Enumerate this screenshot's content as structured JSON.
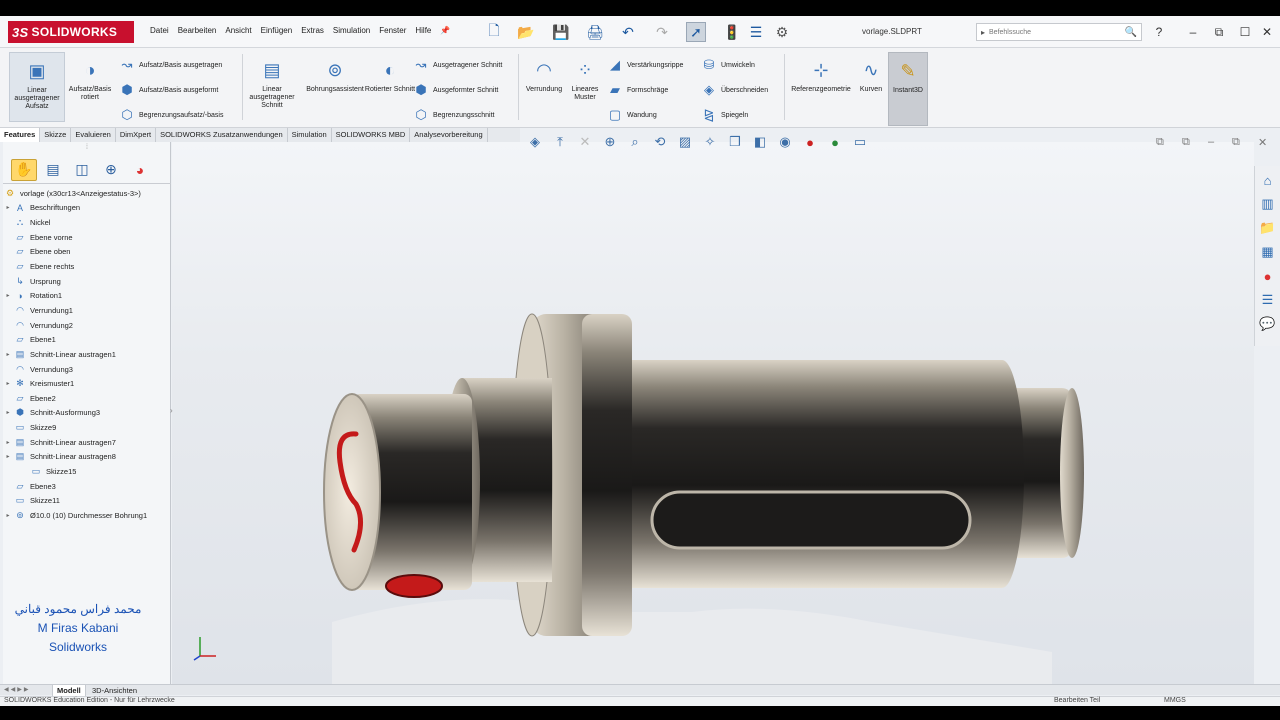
{
  "app": {
    "brand": "SOLIDWORKS",
    "brand_prefix": "3S",
    "document_title": "vorlage.SLDPRT"
  },
  "menu": [
    "Datei",
    "Bearbeiten",
    "Ansicht",
    "Einfügen",
    "Extras",
    "Simulation",
    "Fenster",
    "Hilfe"
  ],
  "search": {
    "placeholder": "Befehlssuche"
  },
  "ribbon": {
    "linear_boss": "Linear ausgetragener Aufsatz",
    "revolve_boss": "Aufsatz/Basis rotiert",
    "swept_boss": "Aufsatz/Basis ausgetragen",
    "lofted_boss": "Aufsatz/Basis ausgeformt",
    "boundary_boss": "Begrenzungsaufsatz/-basis",
    "linear_cut": "Linear ausgetragener Schnitt",
    "hole_wizard": "Bohrungsassistent",
    "revolved_cut": "Rotierter Schnitt",
    "swept_cut": "Ausgetragener Schnitt",
    "lofted_cut": "Ausgeformter Schnitt",
    "boundary_cut": "Begrenzungsschnitt",
    "fillet": "Verrundung",
    "linear_pattern": "Lineares Muster",
    "rib": "Verstärkungsrippe",
    "draft": "Formschräge",
    "shell": "Wandung",
    "wrap": "Umwickeln",
    "intersect": "Überschneiden",
    "mirror": "Spiegeln",
    "ref_geometry": "Referenzgeometrie",
    "curves": "Kurven",
    "instant3d": "Instant3D"
  },
  "cmd_tabs": [
    "Features",
    "Skizze",
    "Evaluieren",
    "DimXpert",
    "SOLIDWORKS Zusatzanwendungen",
    "Simulation",
    "SOLIDWORKS MBD",
    "Analysevorbereitung"
  ],
  "tree": {
    "root": "vorlage  (x30cr13<Anzeigestatus-3>)",
    "items": [
      {
        "label": "Beschriftungen",
        "exp": true,
        "icon": "annotations-icon"
      },
      {
        "label": "Nickel",
        "exp": false,
        "icon": "material-icon"
      },
      {
        "label": "Ebene vorne",
        "exp": false,
        "icon": "plane-icon"
      },
      {
        "label": "Ebene oben",
        "exp": false,
        "icon": "plane-icon"
      },
      {
        "label": "Ebene rechts",
        "exp": false,
        "icon": "plane-icon"
      },
      {
        "label": "Ursprung",
        "exp": false,
        "icon": "origin-icon"
      },
      {
        "label": "Rotation1",
        "exp": true,
        "icon": "revolve-icon"
      },
      {
        "label": "Verrundung1",
        "exp": false,
        "icon": "fillet-icon"
      },
      {
        "label": "Verrundung2",
        "exp": false,
        "icon": "fillet-icon"
      },
      {
        "label": "Ebene1",
        "exp": false,
        "icon": "plane-icon"
      },
      {
        "label": "Schnitt-Linear austragen1",
        "exp": true,
        "icon": "cut-extrude-icon"
      },
      {
        "label": "Verrundung3",
        "exp": false,
        "icon": "fillet-icon"
      },
      {
        "label": "Kreismuster1",
        "exp": true,
        "icon": "pattern-icon"
      },
      {
        "label": "Ebene2",
        "exp": false,
        "icon": "plane-icon"
      },
      {
        "label": "Schnitt-Ausformung3",
        "exp": true,
        "icon": "cut-loft-icon"
      },
      {
        "label": "Skizze9",
        "exp": false,
        "icon": "sketch-icon"
      },
      {
        "label": "Schnitt-Linear austragen7",
        "exp": true,
        "icon": "cut-extrude-icon"
      },
      {
        "label": "Schnitt-Linear austragen8",
        "exp": true,
        "icon": "cut-extrude-icon"
      },
      {
        "label": "Skizze15",
        "exp": false,
        "icon": "sketch-icon",
        "indent": true
      },
      {
        "label": "Ebene3",
        "exp": false,
        "icon": "plane-icon"
      },
      {
        "label": "Skizze11",
        "exp": false,
        "icon": "sketch-icon"
      },
      {
        "label": "Ø10.0 (10) Durchmesser Bohrung1",
        "exp": true,
        "icon": "hole-icon"
      }
    ]
  },
  "watermark": [
    "محمد فراس محمود قباني",
    "M Firas Kabani",
    "Solidworks"
  ],
  "bottom_tabs": [
    "Modell",
    "3D-Ansichten"
  ],
  "status": {
    "left": "SOLIDWORKS Education Edition - Nur für Lehrzwecke",
    "mode": "Bearbeiten Teil",
    "units": "MMGS"
  },
  "colors": {
    "brand_red": "#c8102e",
    "accent_blue": "#3a74b8",
    "cut_red": "#c41a1a"
  }
}
